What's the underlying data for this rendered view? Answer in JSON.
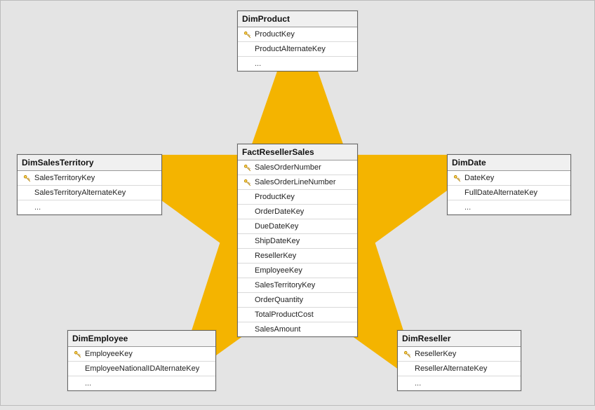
{
  "tables": {
    "DimProduct": {
      "title": "DimProduct",
      "rows": [
        {
          "key": true,
          "label": "ProductKey"
        },
        {
          "key": false,
          "label": "ProductAlternateKey"
        },
        {
          "key": false,
          "label": "...",
          "more": true
        }
      ]
    },
    "DimSalesTerritory": {
      "title": "DimSalesTerritory",
      "rows": [
        {
          "key": true,
          "label": "SalesTerritoryKey"
        },
        {
          "key": false,
          "label": "SalesTerritoryAlternateKey"
        },
        {
          "key": false,
          "label": "...",
          "more": true
        }
      ]
    },
    "FactResellerSales": {
      "title": "FactResellerSales",
      "rows": [
        {
          "key": true,
          "label": "SalesOrderNumber"
        },
        {
          "key": true,
          "label": "SalesOrderLineNumber"
        },
        {
          "key": false,
          "label": "ProductKey"
        },
        {
          "key": false,
          "label": "OrderDateKey"
        },
        {
          "key": false,
          "label": "DueDateKey"
        },
        {
          "key": false,
          "label": "ShipDateKey"
        },
        {
          "key": false,
          "label": "ResellerKey"
        },
        {
          "key": false,
          "label": "EmployeeKey"
        },
        {
          "key": false,
          "label": "SalesTerritoryKey"
        },
        {
          "key": false,
          "label": "OrderQuantity"
        },
        {
          "key": false,
          "label": "TotalProductCost"
        },
        {
          "key": false,
          "label": "SalesAmount"
        }
      ]
    },
    "DimDate": {
      "title": "DimDate",
      "rows": [
        {
          "key": true,
          "label": "DateKey"
        },
        {
          "key": false,
          "label": "FullDateAlternateKey"
        },
        {
          "key": false,
          "label": "...",
          "more": true
        }
      ]
    },
    "DimEmployee": {
      "title": "DimEmployee",
      "rows": [
        {
          "key": true,
          "label": "EmployeeKey"
        },
        {
          "key": false,
          "label": "EmployeeNationalIDAlternateKey"
        },
        {
          "key": false,
          "label": "...",
          "more": true
        }
      ]
    },
    "DimReseller": {
      "title": "DimReseller",
      "rows": [
        {
          "key": true,
          "label": "ResellerKey"
        },
        {
          "key": false,
          "label": "ResellerAlternateKey"
        },
        {
          "key": false,
          "label": "...",
          "more": true
        }
      ]
    }
  }
}
